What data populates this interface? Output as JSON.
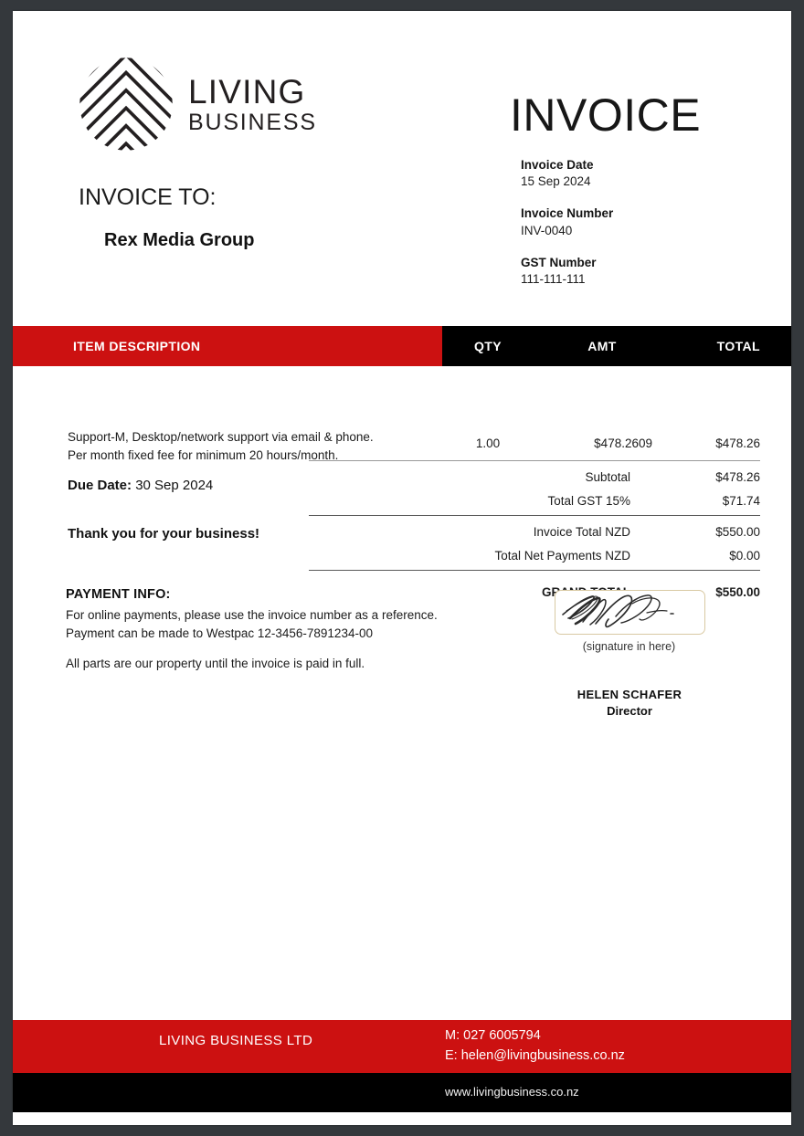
{
  "brand": {
    "logo_line1": "LIVING",
    "logo_line2": "BUSINESS",
    "accent_red": "#cc1111",
    "black": "#000000"
  },
  "header": {
    "doc_title": "INVOICE",
    "invoice_to_label": "INVOICE TO:",
    "customer_name": "Rex Media Group",
    "meta": [
      {
        "label": "Invoice Date",
        "value": "15 Sep 2024"
      },
      {
        "label": "Invoice Number",
        "value": "INV-0040"
      },
      {
        "label": "GST Number",
        "value": "111-111-111"
      }
    ]
  },
  "table": {
    "columns": {
      "description": "ITEM DESCRIPTION",
      "qty": "QTY",
      "amt": "AMT",
      "total": "TOTAL"
    },
    "line_items": [
      {
        "description_line1": "Support-M, Desktop/network support via email & phone.",
        "description_line2": "Per month fixed fee for minimum 20 hours/month.",
        "qty": "1.00",
        "amt": "$478.2609",
        "total": "$478.26"
      }
    ]
  },
  "totals": [
    {
      "label": "Subtotal",
      "value": "$478.26"
    },
    {
      "label": "Total GST 15%",
      "value": "$71.74"
    },
    {
      "label": "Invoice Total NZD",
      "value": "$550.00"
    },
    {
      "label": "Total Net Payments NZD",
      "value": "$0.00"
    }
  ],
  "grand_total": {
    "label": "GRAND TOTAL",
    "value": "$550.00"
  },
  "notes": {
    "due_date_label": "Due Date:",
    "due_date_value": "30 Sep 2024",
    "thank_you": "Thank you for your business!"
  },
  "payment_info": {
    "title": "PAYMENT INFO:",
    "line1": "For online payments, please use the invoice number as a reference.",
    "line2": "Payment can be made to Westpac 12-3456-7891234-00",
    "line3": "All parts are our property until the invoice is paid in full."
  },
  "signature": {
    "caption": "(signature in here)",
    "name": "HELEN SCHAFER",
    "role": "Director"
  },
  "footer": {
    "company": "LIVING BUSINESS LTD",
    "mobile": "M:  027 6005794",
    "email": "E: helen@livingbusiness.co.nz",
    "website": "www.livingbusiness.co.nz"
  }
}
